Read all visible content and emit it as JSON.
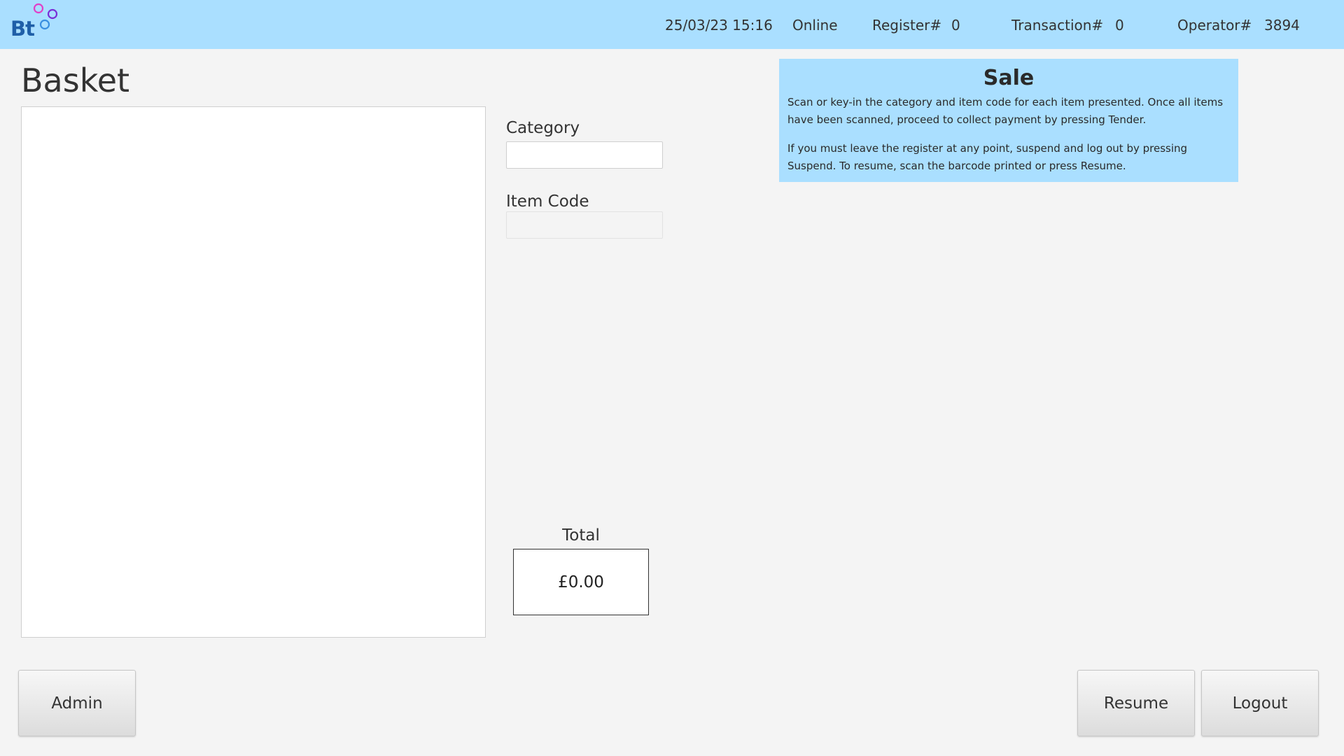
{
  "app": {
    "logo_text": "Bt"
  },
  "status_bar": {
    "datetime": "25/03/23 15:16",
    "connection": "Online",
    "register_label": "Register#",
    "register_value": "0",
    "transaction_label": "Transaction#",
    "transaction_value": "0",
    "operator_label": "Operator#",
    "operator_value": "3894"
  },
  "basket": {
    "title": "Basket",
    "items": []
  },
  "form": {
    "category_label": "Category",
    "category_value": "",
    "item_code_label": "Item Code",
    "item_code_value": ""
  },
  "total": {
    "label": "Total",
    "value": "£0.00"
  },
  "info": {
    "title": "Sale",
    "paragraph1": "Scan or key-in the category and item code for each item presented. Once all items have been scanned, proceed to collect payment by pressing Tender.",
    "paragraph2": "If you must leave the register at any point, suspend and log out by pressing Suspend. To resume, scan the barcode printed or press Resume."
  },
  "buttons": {
    "admin": "Admin",
    "resume": "Resume",
    "logout": "Logout"
  },
  "colors": {
    "header_bg": "#aadfff",
    "info_bg": "#aadfff",
    "page_bg": "#f4f4f4",
    "logo_blue": "#1f5fa8",
    "logo_ring_pink": "#e040c8",
    "logo_ring_purple": "#7a2fd6",
    "logo_ring_blue": "#3a8fe0"
  }
}
